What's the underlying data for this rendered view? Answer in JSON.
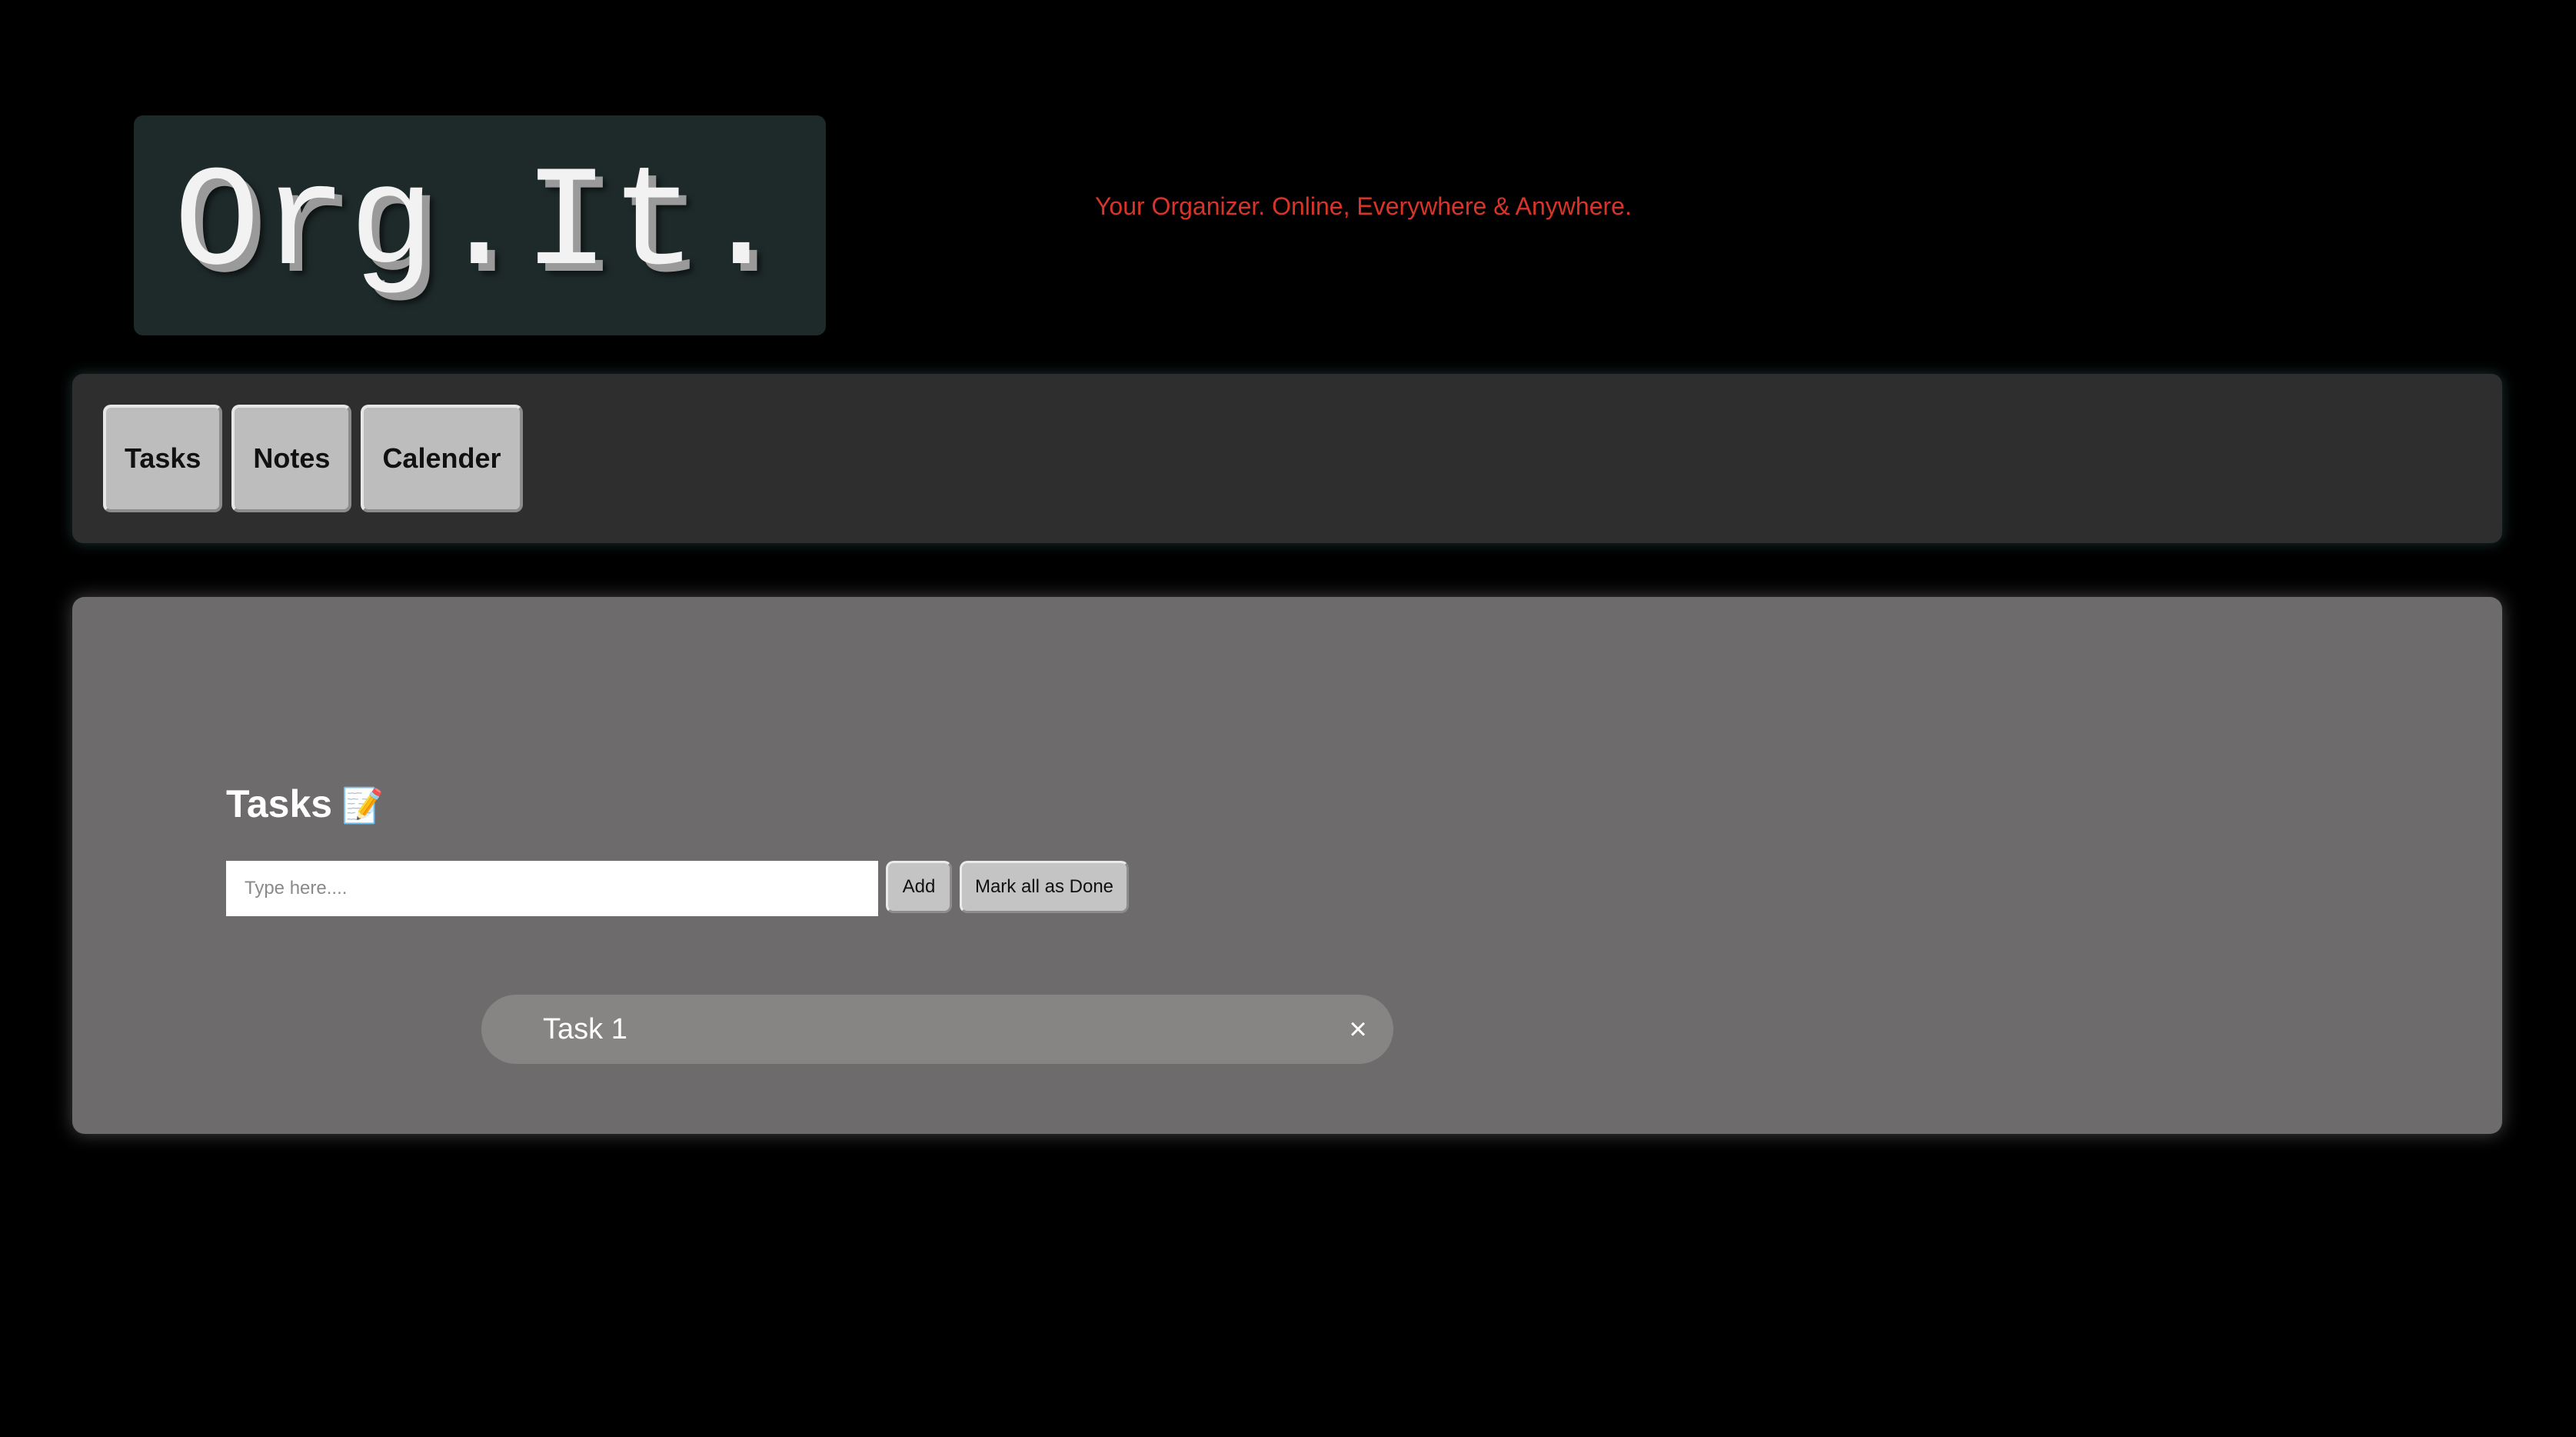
{
  "header": {
    "logo_text": "Org.It.",
    "tagline": "Your Organizer. Online, Everywhere & Anywhere."
  },
  "nav": {
    "items": [
      {
        "label": "Tasks"
      },
      {
        "label": "Notes"
      },
      {
        "label": "Calender"
      }
    ]
  },
  "tasks_panel": {
    "heading": "Tasks",
    "heading_icon": "📝",
    "input": {
      "value": "",
      "placeholder": "Type here...."
    },
    "add_label": "Add",
    "mark_all_done_label": "Mark all as Done",
    "items": [
      {
        "text": "Task 1",
        "close_icon": "×"
      }
    ]
  },
  "colors": {
    "background": "#000000",
    "logo_bg": "#1e2a2a",
    "tagline": "#d8342a",
    "navbar_bg": "#2e2e2e",
    "panel_bg": "#6d6b6b",
    "task_item_bg": "#878584",
    "button_bg": "#c4c4c4"
  }
}
